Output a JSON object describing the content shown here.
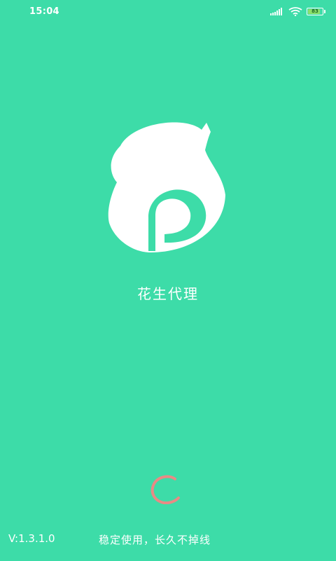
{
  "status_bar": {
    "time": "15:04",
    "battery_level": "83",
    "icons": [
      "signal-icon",
      "wifi-icon",
      "battery-icon"
    ]
  },
  "splash": {
    "app_name": "花生代理",
    "logo_icon": "peanut-p-logo-icon",
    "loading_icon": "loading-spinner-icon"
  },
  "footer": {
    "version": "V:1.3.1.0",
    "slogan": "稳定使用，长久不掉线"
  },
  "colors": {
    "background": "#3ddca8",
    "logo": "#ffffff",
    "spinner": "#e88b85",
    "battery_fill": "#8de06a"
  }
}
